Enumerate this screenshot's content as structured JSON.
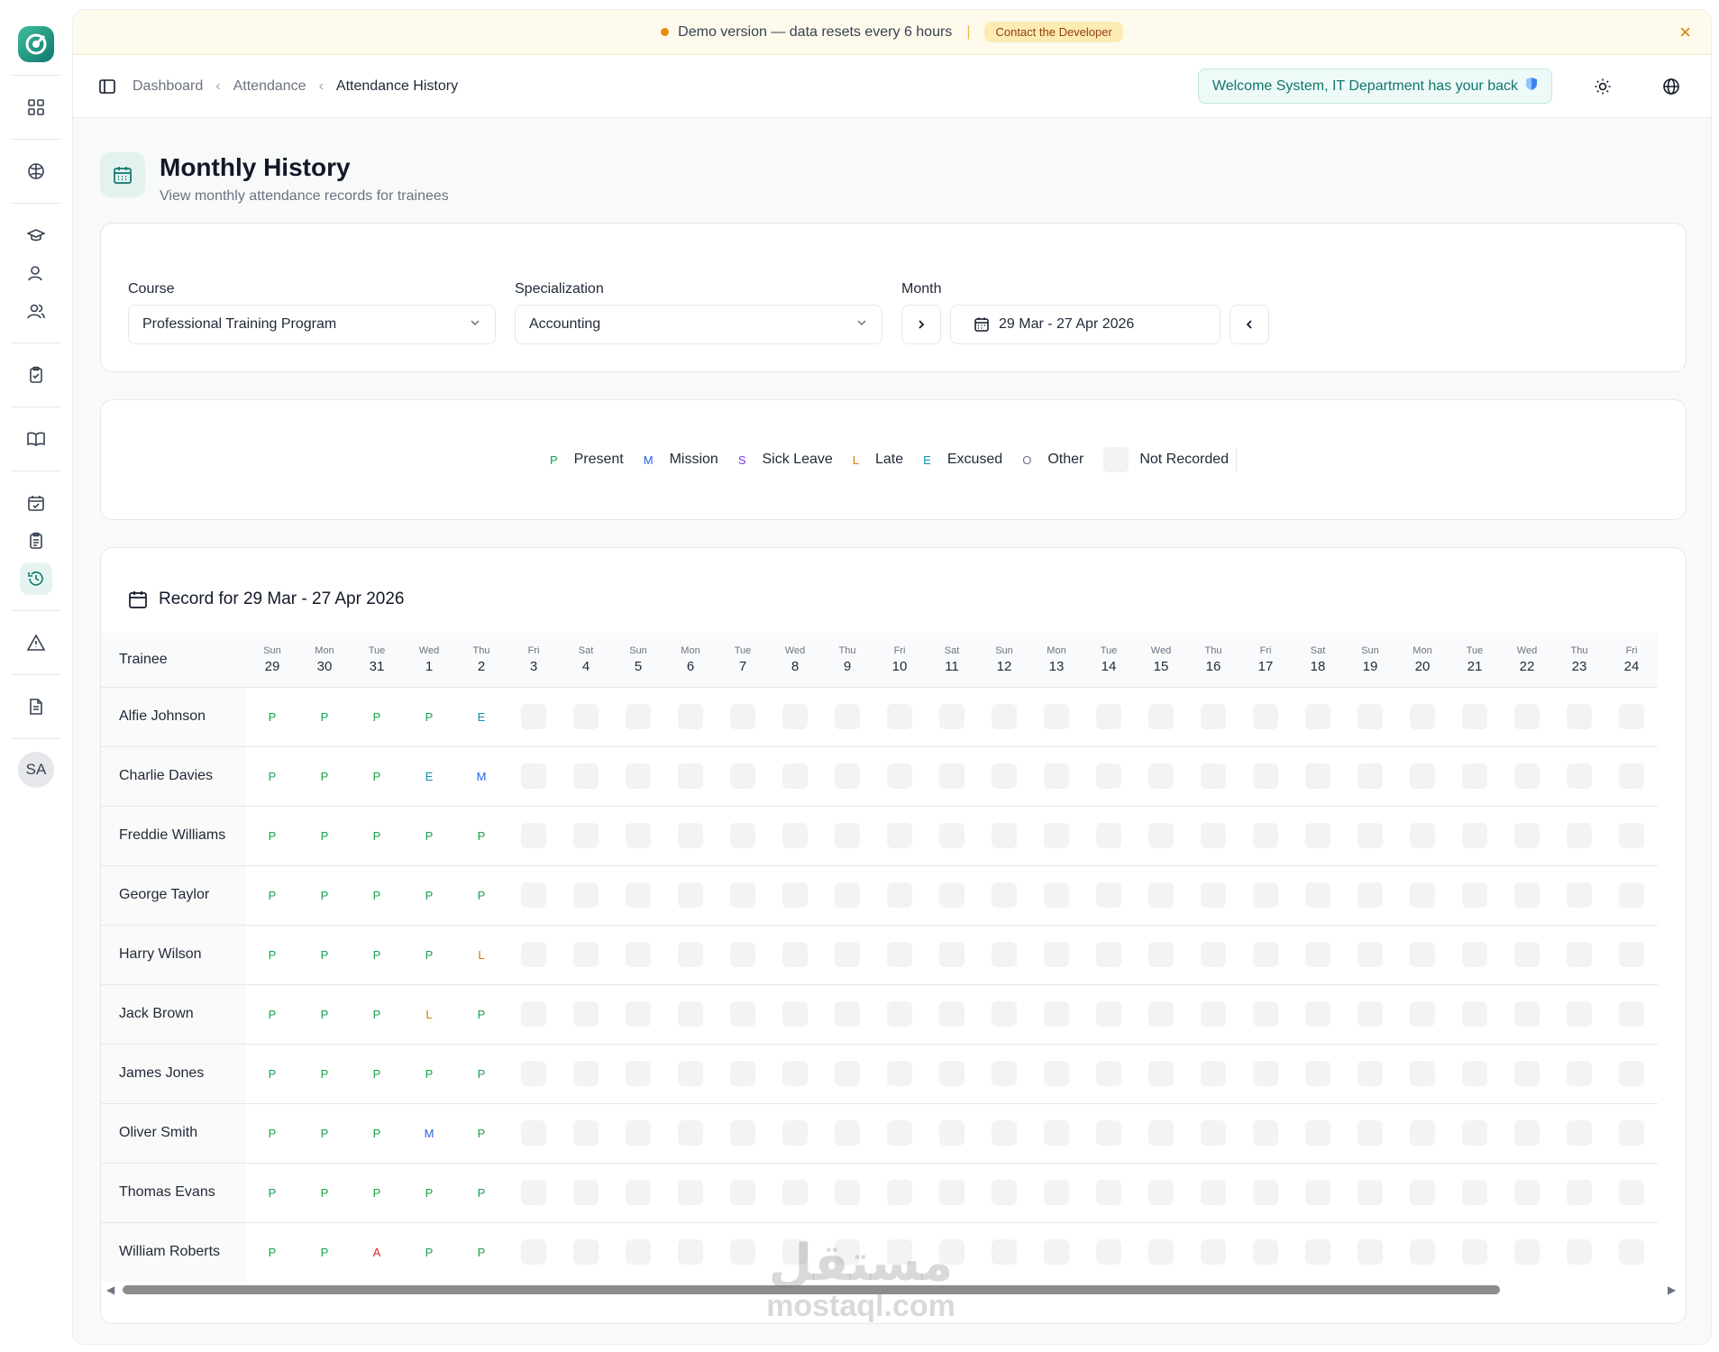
{
  "sidebar": {
    "avatar_initials": "SA",
    "icons": [
      "dashboard-icon",
      "globe-brain-icon",
      "graduation-cap-icon",
      "user-icon",
      "users-icon",
      "clipboard-check-icon",
      "book-open-icon",
      "calendar-check-icon",
      "clipboard-list-icon",
      "history-icon",
      "warning-icon",
      "document-icon"
    ],
    "active": "history-icon"
  },
  "banner": {
    "message": "Demo version — data resets every 6 hours",
    "contact_label": "Contact the Developer",
    "close_symbol": "×"
  },
  "topbar": {
    "breadcrumbs": [
      "Dashboard",
      "Attendance",
      "Attendance History"
    ],
    "welcome": "Welcome System, IT Department has your back"
  },
  "page": {
    "title": "Monthly History",
    "subtitle": "View monthly attendance records for trainees"
  },
  "filters": {
    "course_label": "Course",
    "course_value": "Professional Training Program",
    "specialization_label": "Specialization",
    "specialization_value": "Accounting",
    "month_label": "Month",
    "month_value": "29 Mar - 27 Apr 2026"
  },
  "legend": [
    {
      "code": "P",
      "label": "Present"
    },
    {
      "code": "M",
      "label": "Mission"
    },
    {
      "code": "S",
      "label": "Sick Leave"
    },
    {
      "code": "L",
      "label": "Late"
    },
    {
      "code": "E",
      "label": "Excused"
    },
    {
      "code": "O",
      "label": "Other"
    },
    {
      "code": "",
      "label": "Not Recorded"
    }
  ],
  "record": {
    "title": "Record for 29 Mar - 27 Apr 2026",
    "trainee_header": "Trainee",
    "days": [
      {
        "dow": "Sun",
        "day": "29"
      },
      {
        "dow": "Mon",
        "day": "30"
      },
      {
        "dow": "Tue",
        "day": "31"
      },
      {
        "dow": "Wed",
        "day": "1"
      },
      {
        "dow": "Thu",
        "day": "2"
      },
      {
        "dow": "Fri",
        "day": "3"
      },
      {
        "dow": "Sat",
        "day": "4"
      },
      {
        "dow": "Sun",
        "day": "5"
      },
      {
        "dow": "Mon",
        "day": "6"
      },
      {
        "dow": "Tue",
        "day": "7"
      },
      {
        "dow": "Wed",
        "day": "8"
      },
      {
        "dow": "Thu",
        "day": "9"
      },
      {
        "dow": "Fri",
        "day": "10"
      },
      {
        "dow": "Sat",
        "day": "11"
      },
      {
        "dow": "Sun",
        "day": "12"
      },
      {
        "dow": "Mon",
        "day": "13"
      },
      {
        "dow": "Tue",
        "day": "14"
      },
      {
        "dow": "Wed",
        "day": "15"
      },
      {
        "dow": "Thu",
        "day": "16"
      },
      {
        "dow": "Fri",
        "day": "17"
      },
      {
        "dow": "Sat",
        "day": "18"
      },
      {
        "dow": "Sun",
        "day": "19"
      },
      {
        "dow": "Mon",
        "day": "20"
      },
      {
        "dow": "Tue",
        "day": "21"
      },
      {
        "dow": "Wed",
        "day": "22"
      },
      {
        "dow": "Thu",
        "day": "23"
      },
      {
        "dow": "Fri",
        "day": "24"
      }
    ],
    "rows": [
      {
        "name": "Alfie Johnson",
        "marks": [
          "P",
          "P",
          "P",
          "P",
          "E"
        ]
      },
      {
        "name": "Charlie Davies",
        "marks": [
          "P",
          "P",
          "P",
          "E",
          "M"
        ]
      },
      {
        "name": "Freddie Williams",
        "marks": [
          "P",
          "P",
          "P",
          "P",
          "P"
        ]
      },
      {
        "name": "George Taylor",
        "marks": [
          "P",
          "P",
          "P",
          "P",
          "P"
        ]
      },
      {
        "name": "Harry Wilson",
        "marks": [
          "P",
          "P",
          "P",
          "P",
          "L"
        ]
      },
      {
        "name": "Jack Brown",
        "marks": [
          "P",
          "P",
          "P",
          "L",
          "P"
        ]
      },
      {
        "name": "James Jones",
        "marks": [
          "P",
          "P",
          "P",
          "P",
          "P"
        ]
      },
      {
        "name": "Oliver Smith",
        "marks": [
          "P",
          "P",
          "P",
          "M",
          "P"
        ]
      },
      {
        "name": "Thomas Evans",
        "marks": [
          "P",
          "P",
          "P",
          "P",
          "P"
        ]
      },
      {
        "name": "William Roberts",
        "marks": [
          "P",
          "P",
          "A",
          "P",
          "P"
        ]
      }
    ]
  },
  "watermark": {
    "arabic": "مستقل",
    "latin": "mostaql.com"
  }
}
